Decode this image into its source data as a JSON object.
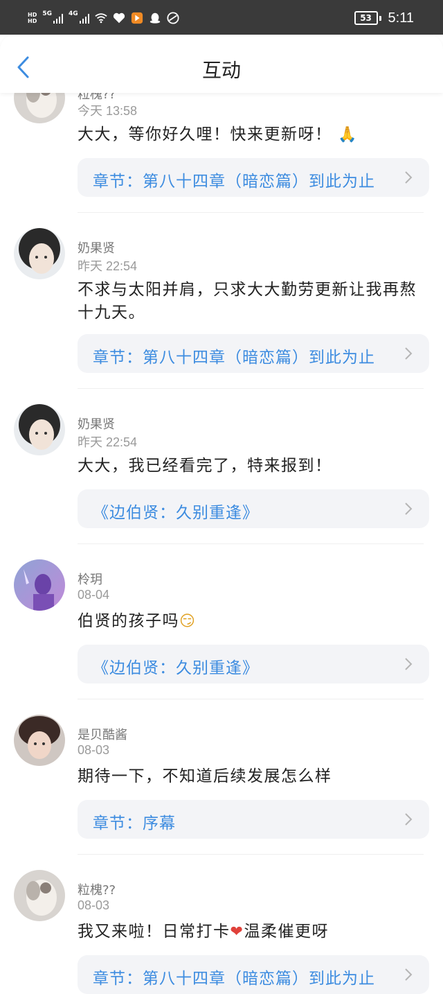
{
  "status_bar": {
    "hd1": "HD",
    "hd2": "HD",
    "net1": "5G",
    "net2": "4G",
    "battery": "53",
    "time": "5:11"
  },
  "header": {
    "title": "互动"
  },
  "comments": [
    {
      "name": "粒槐??",
      "time": "今天 13:58",
      "text": "大大，等你好久哩！快来更新呀！",
      "emoji": "🙏",
      "ref": "章节：第八十四章（暗恋篇）到此为止"
    },
    {
      "name": "奶果贤",
      "time": "昨天 22:54",
      "text": "不求与太阳并肩，只求大大勤劳更新让我再熬十九天。",
      "emoji": "",
      "ref": "章节：第八十四章（暗恋篇）到此为止"
    },
    {
      "name": "奶果贤",
      "time": "昨天 22:54",
      "text": "大大，我已经看完了，特来报到！",
      "emoji": "",
      "ref": "《边伯贤：久别重逢》"
    },
    {
      "name": "柃玥",
      "time": "08-04",
      "text": "伯贤的孩子吗",
      "emoji": "😏",
      "ref": "《边伯贤：久别重逢》"
    },
    {
      "name": "是贝酷酱",
      "time": "08-03",
      "text": "期待一下，不知道后续发展怎么样",
      "emoji": "",
      "ref": "章节：序幕"
    },
    {
      "name": "粒槐??",
      "time": "08-03",
      "text": "我又来啦！日常打卡",
      "emoji": "❤",
      "text2": "温柔催更呀",
      "ref": "章节：第八十四章（暗恋篇）到此为止"
    }
  ],
  "colors": {
    "accent": "#3d8ce0",
    "status_bar": "#3a3a3a",
    "ref_bg": "#f3f4f7"
  }
}
